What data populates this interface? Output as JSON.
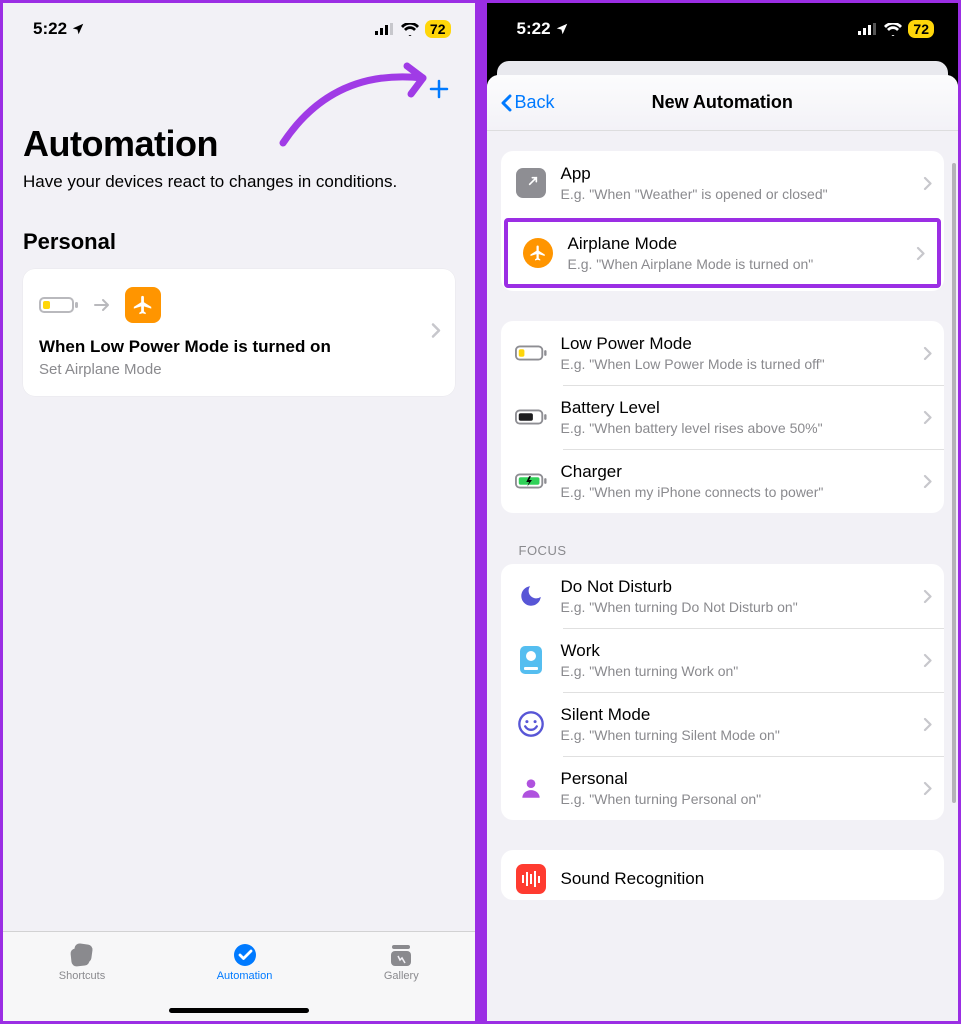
{
  "status": {
    "time": "5:22",
    "battery": "72"
  },
  "left": {
    "title": "Automation",
    "subtitle": "Have your devices react to changes in conditions.",
    "personal_header": "Personal",
    "card": {
      "title": "When Low Power Mode is turned on",
      "subtitle": "Set Airplane Mode"
    },
    "tabs": {
      "shortcuts": "Shortcuts",
      "automation": "Automation",
      "gallery": "Gallery"
    }
  },
  "right": {
    "back": "Back",
    "title": "New Automation",
    "group1": [
      {
        "title": "App",
        "sub": "E.g. \"When \"Weather\" is opened or closed\""
      },
      {
        "title": "Airplane Mode",
        "sub": "E.g. \"When Airplane Mode is turned on\""
      }
    ],
    "group2": [
      {
        "title": "Low Power Mode",
        "sub": "E.g. \"When Low Power Mode is turned off\""
      },
      {
        "title": "Battery Level",
        "sub": "E.g. \"When battery level rises above 50%\""
      },
      {
        "title": "Charger",
        "sub": "E.g. \"When my iPhone connects to power\""
      }
    ],
    "focus_header": "FOCUS",
    "group3": [
      {
        "title": "Do Not Disturb",
        "sub": "E.g. \"When turning Do Not Disturb on\""
      },
      {
        "title": "Work",
        "sub": "E.g. \"When turning Work on\""
      },
      {
        "title": "Silent Mode",
        "sub": "E.g. \"When turning Silent Mode  on\""
      },
      {
        "title": "Personal",
        "sub": "E.g. \"When turning Personal on\""
      }
    ],
    "group4": [
      {
        "title": "Sound Recognition",
        "sub": ""
      }
    ]
  }
}
